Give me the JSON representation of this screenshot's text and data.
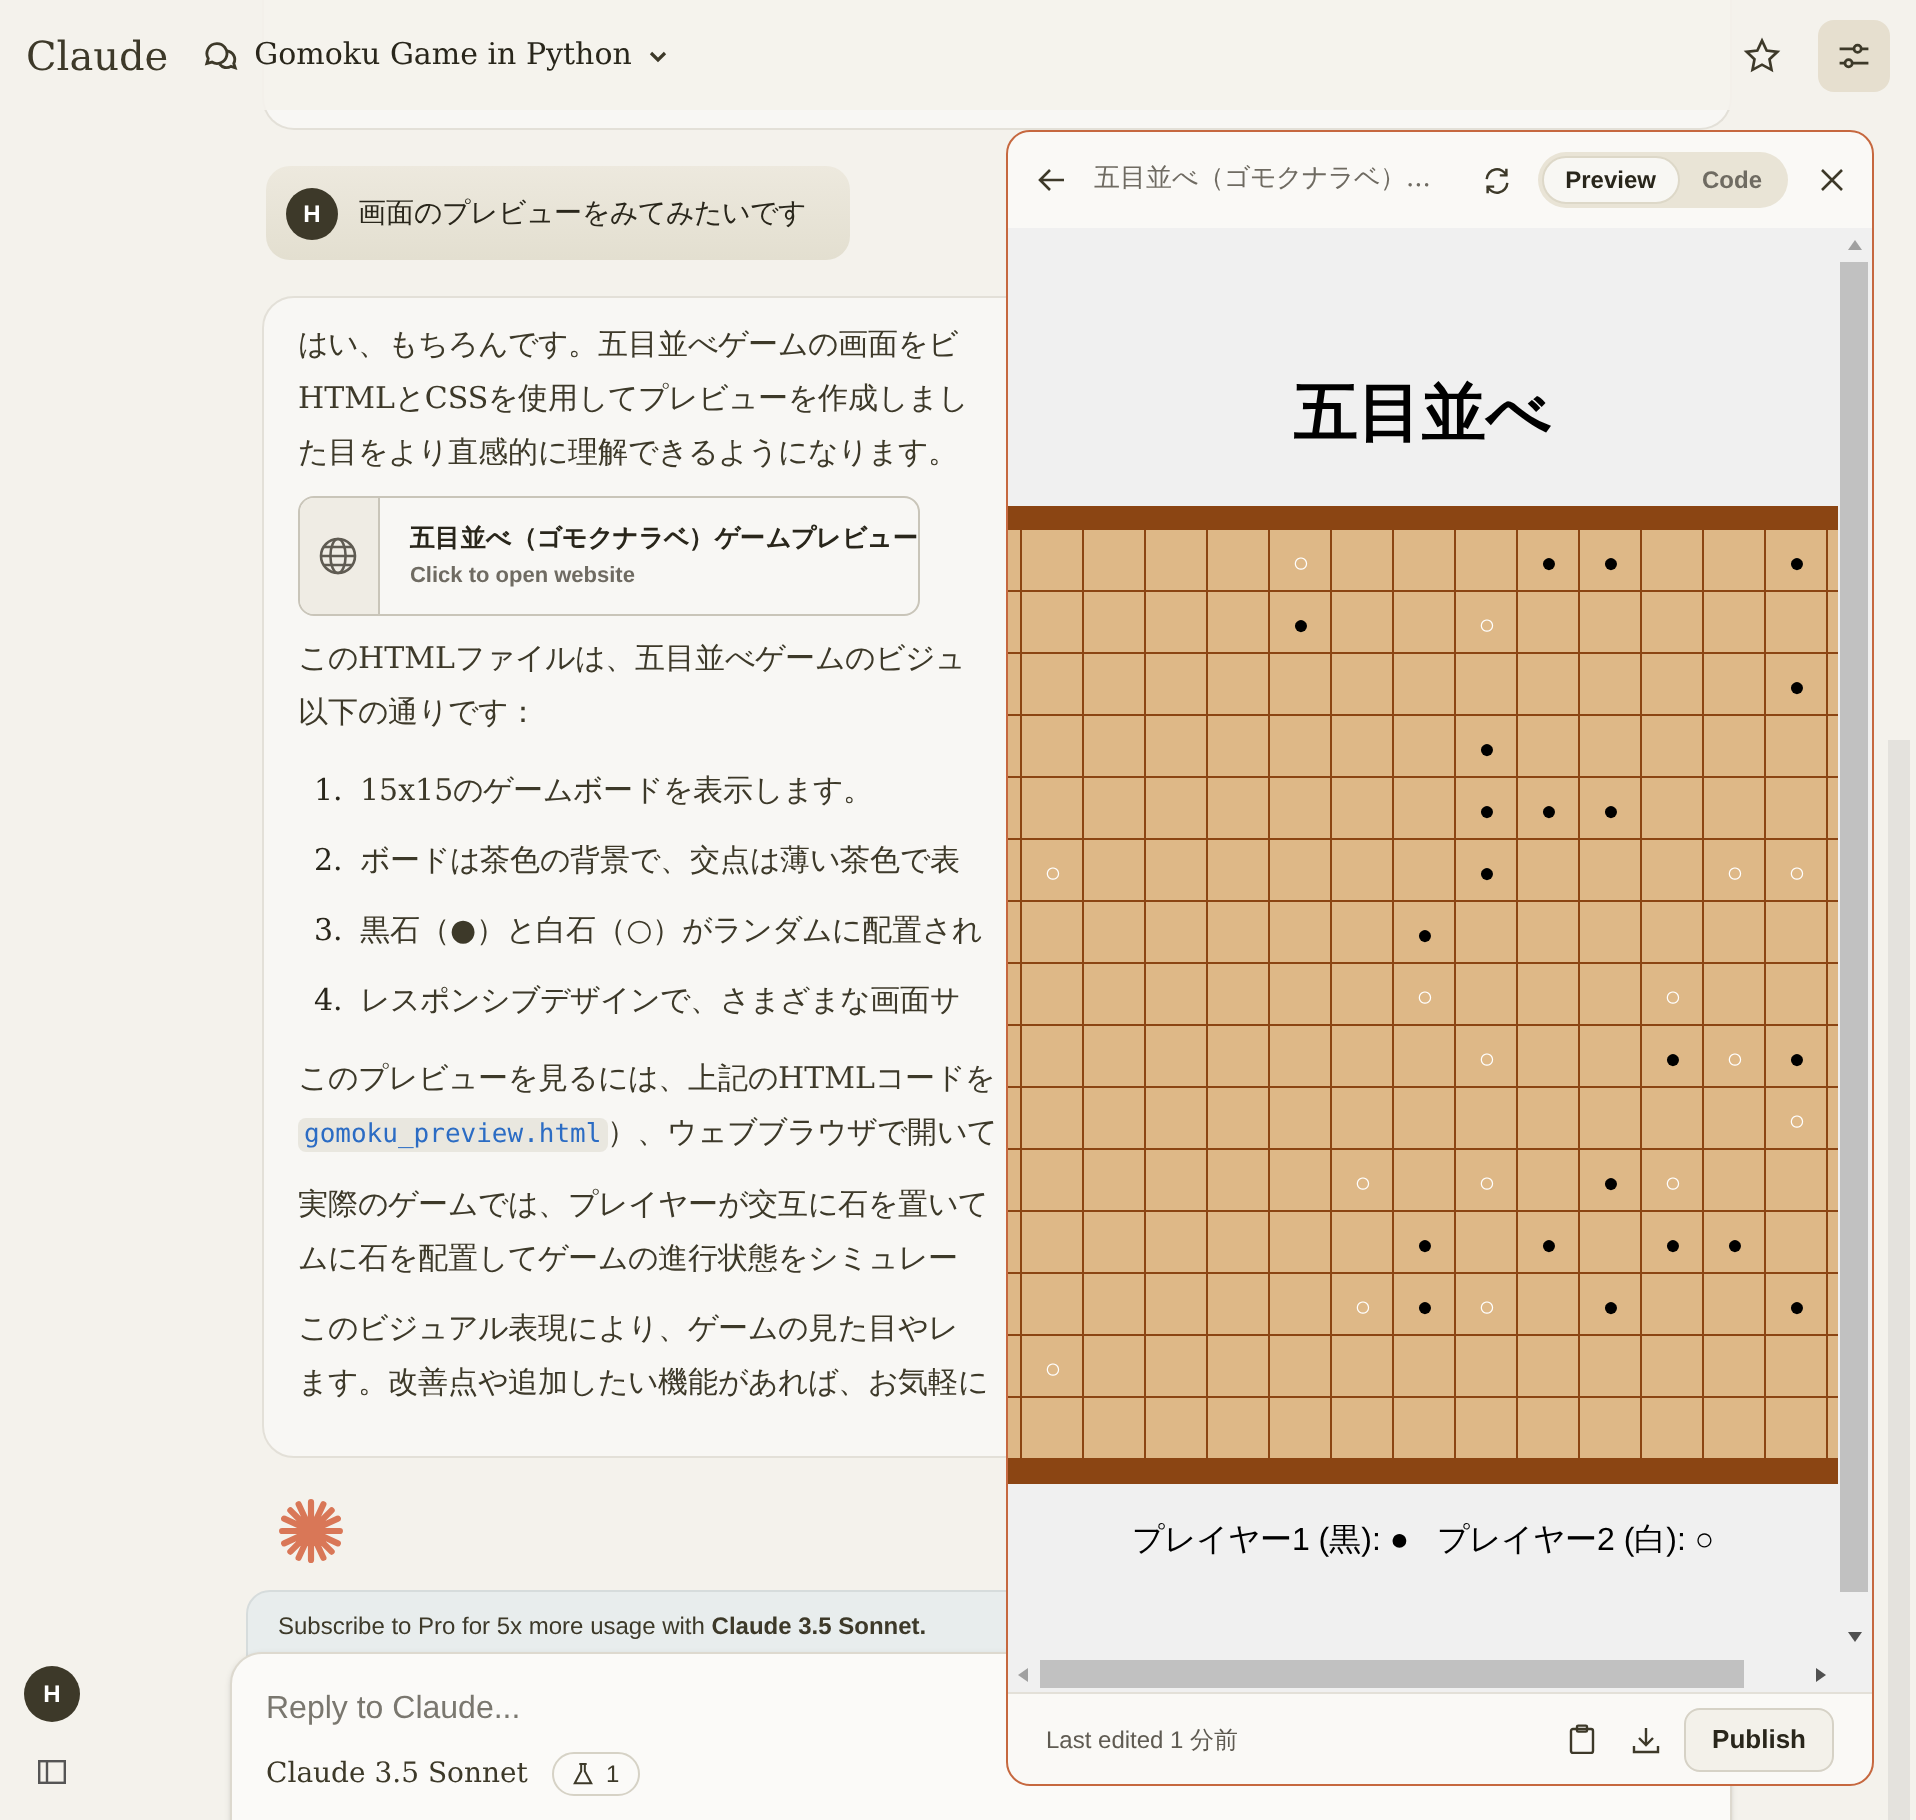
{
  "header": {
    "logo": "Claude",
    "chat_title": "Gomoku Game in Python"
  },
  "user_message": {
    "avatar": "H",
    "text": "画面のプレビューをみてみたいです"
  },
  "assistant_message": {
    "blocks": [
      {
        "kind": "paragraph",
        "lines": [
          "はい、もちろんです。五目並べゲームの画面をビ",
          "HTMLとCSSを使用してプレビューを作成しまし",
          "た目をより直感的に理解できるようになります。"
        ]
      },
      {
        "kind": "artifact_card",
        "title": "五目並べ（ゴモクナラベ）ゲームプレビュー",
        "subtitle": "Click to open website"
      },
      {
        "kind": "paragraph",
        "lines": [
          "このHTMLファイルは、五目並べゲームのビジュ",
          "以下の通りです："
        ]
      },
      {
        "kind": "list",
        "items": [
          {
            "number": "1.",
            "text": "15x15のゲームボードを表示します。"
          },
          {
            "number": "2.",
            "text": "ボードは茶色の背景で、交点は薄い茶色で表"
          },
          {
            "number": "3.",
            "text": "黒石（●）と白石（○）がランダムに配置され"
          },
          {
            "number": "4.",
            "text": "レスポンシブデザインで、さまざまな画面サ"
          }
        ]
      },
      {
        "kind": "paragraph",
        "lines": [
          "このプレビューを見るには、上記のHTMLコードを",
          {
            "code": "gomoku_preview.html",
            "after": "）、ウェブブラウザで開いて"
          }
        ]
      },
      {
        "kind": "paragraph",
        "lines": [
          "実際のゲームでは、プレイヤーが交互に石を置いて",
          "ムに石を配置してゲームの進行状態をシミュレー"
        ]
      },
      {
        "kind": "paragraph",
        "lines": [
          "このビジュアル表現により、ゲームの見た目やレ",
          "ます。改善点や追加したい機能があれば、お気軽に"
        ]
      }
    ]
  },
  "artifact": {
    "title": "五目並べ（ゴモクナラベ）...",
    "tabs": [
      {
        "label": "Preview",
        "selected": true
      },
      {
        "label": "Code",
        "selected": false
      }
    ],
    "preview": {
      "heading": "五目並べ",
      "board": {
        "rows": [
          [
            null,
            null,
            null,
            null,
            {
              "kind": "white",
              "stone": "○"
            },
            null,
            null,
            null,
            {
              "kind": "black",
              "stone": "●"
            },
            {
              "kind": "black",
              "stone": "●"
            },
            null,
            null,
            {
              "kind": "black",
              "stone": "●"
            }
          ],
          [
            null,
            null,
            null,
            null,
            {
              "kind": "black",
              "stone": "●"
            },
            null,
            null,
            {
              "kind": "white",
              "stone": "○"
            },
            null,
            null,
            null,
            null,
            null
          ],
          [
            null,
            null,
            null,
            null,
            null,
            null,
            null,
            null,
            null,
            null,
            null,
            null,
            {
              "kind": "black",
              "stone": "●"
            }
          ],
          [
            null,
            null,
            null,
            null,
            null,
            null,
            null,
            {
              "kind": "black",
              "stone": "●"
            },
            null,
            null,
            null,
            null,
            null
          ],
          [
            null,
            null,
            null,
            null,
            null,
            null,
            null,
            {
              "kind": "black",
              "stone": "●"
            },
            {
              "kind": "black",
              "stone": "●"
            },
            {
              "kind": "black",
              "stone": "●"
            },
            null,
            null,
            null
          ],
          [
            {
              "kind": "white",
              "stone": "○"
            },
            null,
            null,
            null,
            null,
            null,
            null,
            {
              "kind": "black",
              "stone": "●"
            },
            null,
            null,
            null,
            {
              "kind": "white",
              "stone": "○"
            },
            {
              "kind": "white",
              "stone": "○"
            }
          ],
          [
            null,
            null,
            null,
            null,
            null,
            null,
            {
              "kind": "black",
              "stone": "●"
            },
            null,
            null,
            null,
            null,
            null,
            null
          ],
          [
            null,
            null,
            null,
            null,
            null,
            null,
            {
              "kind": "white",
              "stone": "○"
            },
            null,
            null,
            null,
            {
              "kind": "white",
              "stone": "○"
            },
            null,
            null
          ],
          [
            null,
            null,
            null,
            null,
            null,
            null,
            null,
            {
              "kind": "white",
              "stone": "○"
            },
            null,
            null,
            {
              "kind": "black",
              "stone": "●"
            },
            {
              "kind": "white",
              "stone": "○"
            },
            {
              "kind": "black",
              "stone": "●"
            }
          ],
          [
            null,
            null,
            null,
            null,
            null,
            null,
            null,
            null,
            null,
            null,
            null,
            null,
            {
              "kind": "white",
              "stone": "○"
            }
          ],
          [
            null,
            null,
            null,
            null,
            null,
            {
              "kind": "white",
              "stone": "○"
            },
            null,
            {
              "kind": "white",
              "stone": "○"
            },
            null,
            {
              "kind": "black",
              "stone": "●"
            },
            {
              "kind": "white",
              "stone": "○"
            },
            null,
            null
          ],
          [
            null,
            null,
            null,
            null,
            null,
            null,
            {
              "kind": "black",
              "stone": "●"
            },
            null,
            {
              "kind": "black",
              "stone": "●"
            },
            null,
            {
              "kind": "black",
              "stone": "●"
            },
            {
              "kind": "black",
              "stone": "●"
            },
            null
          ],
          [
            null,
            null,
            null,
            null,
            null,
            {
              "kind": "white",
              "stone": "○"
            },
            {
              "kind": "black",
              "stone": "●"
            },
            {
              "kind": "white",
              "stone": "○"
            },
            null,
            {
              "kind": "black",
              "stone": "●"
            },
            null,
            null,
            {
              "kind": "black",
              "stone": "●"
            }
          ],
          [
            {
              "kind": "white",
              "stone": "○"
            },
            null,
            null,
            null,
            null,
            null,
            null,
            null,
            null,
            null,
            null,
            null,
            null
          ],
          [
            null,
            null,
            null,
            null,
            null,
            null,
            null,
            null,
            null,
            null,
            null,
            null,
            null
          ]
        ]
      },
      "legend": [
        "プレイヤー1 (黒): ●",
        "プレイヤー2 (白): ○"
      ]
    },
    "footer": {
      "last_edited": "Last edited 1 分前",
      "publish": "Publish"
    }
  },
  "banner": "Subscribe to Pro for 5x more usage with **Claude 3.5 Sonnet.**",
  "composer": {
    "placeholder": "Reply to Claude...",
    "model": "Claude 3.5 Sonnet",
    "badge": "1"
  },
  "sidebar": {
    "avatar": "H"
  }
}
